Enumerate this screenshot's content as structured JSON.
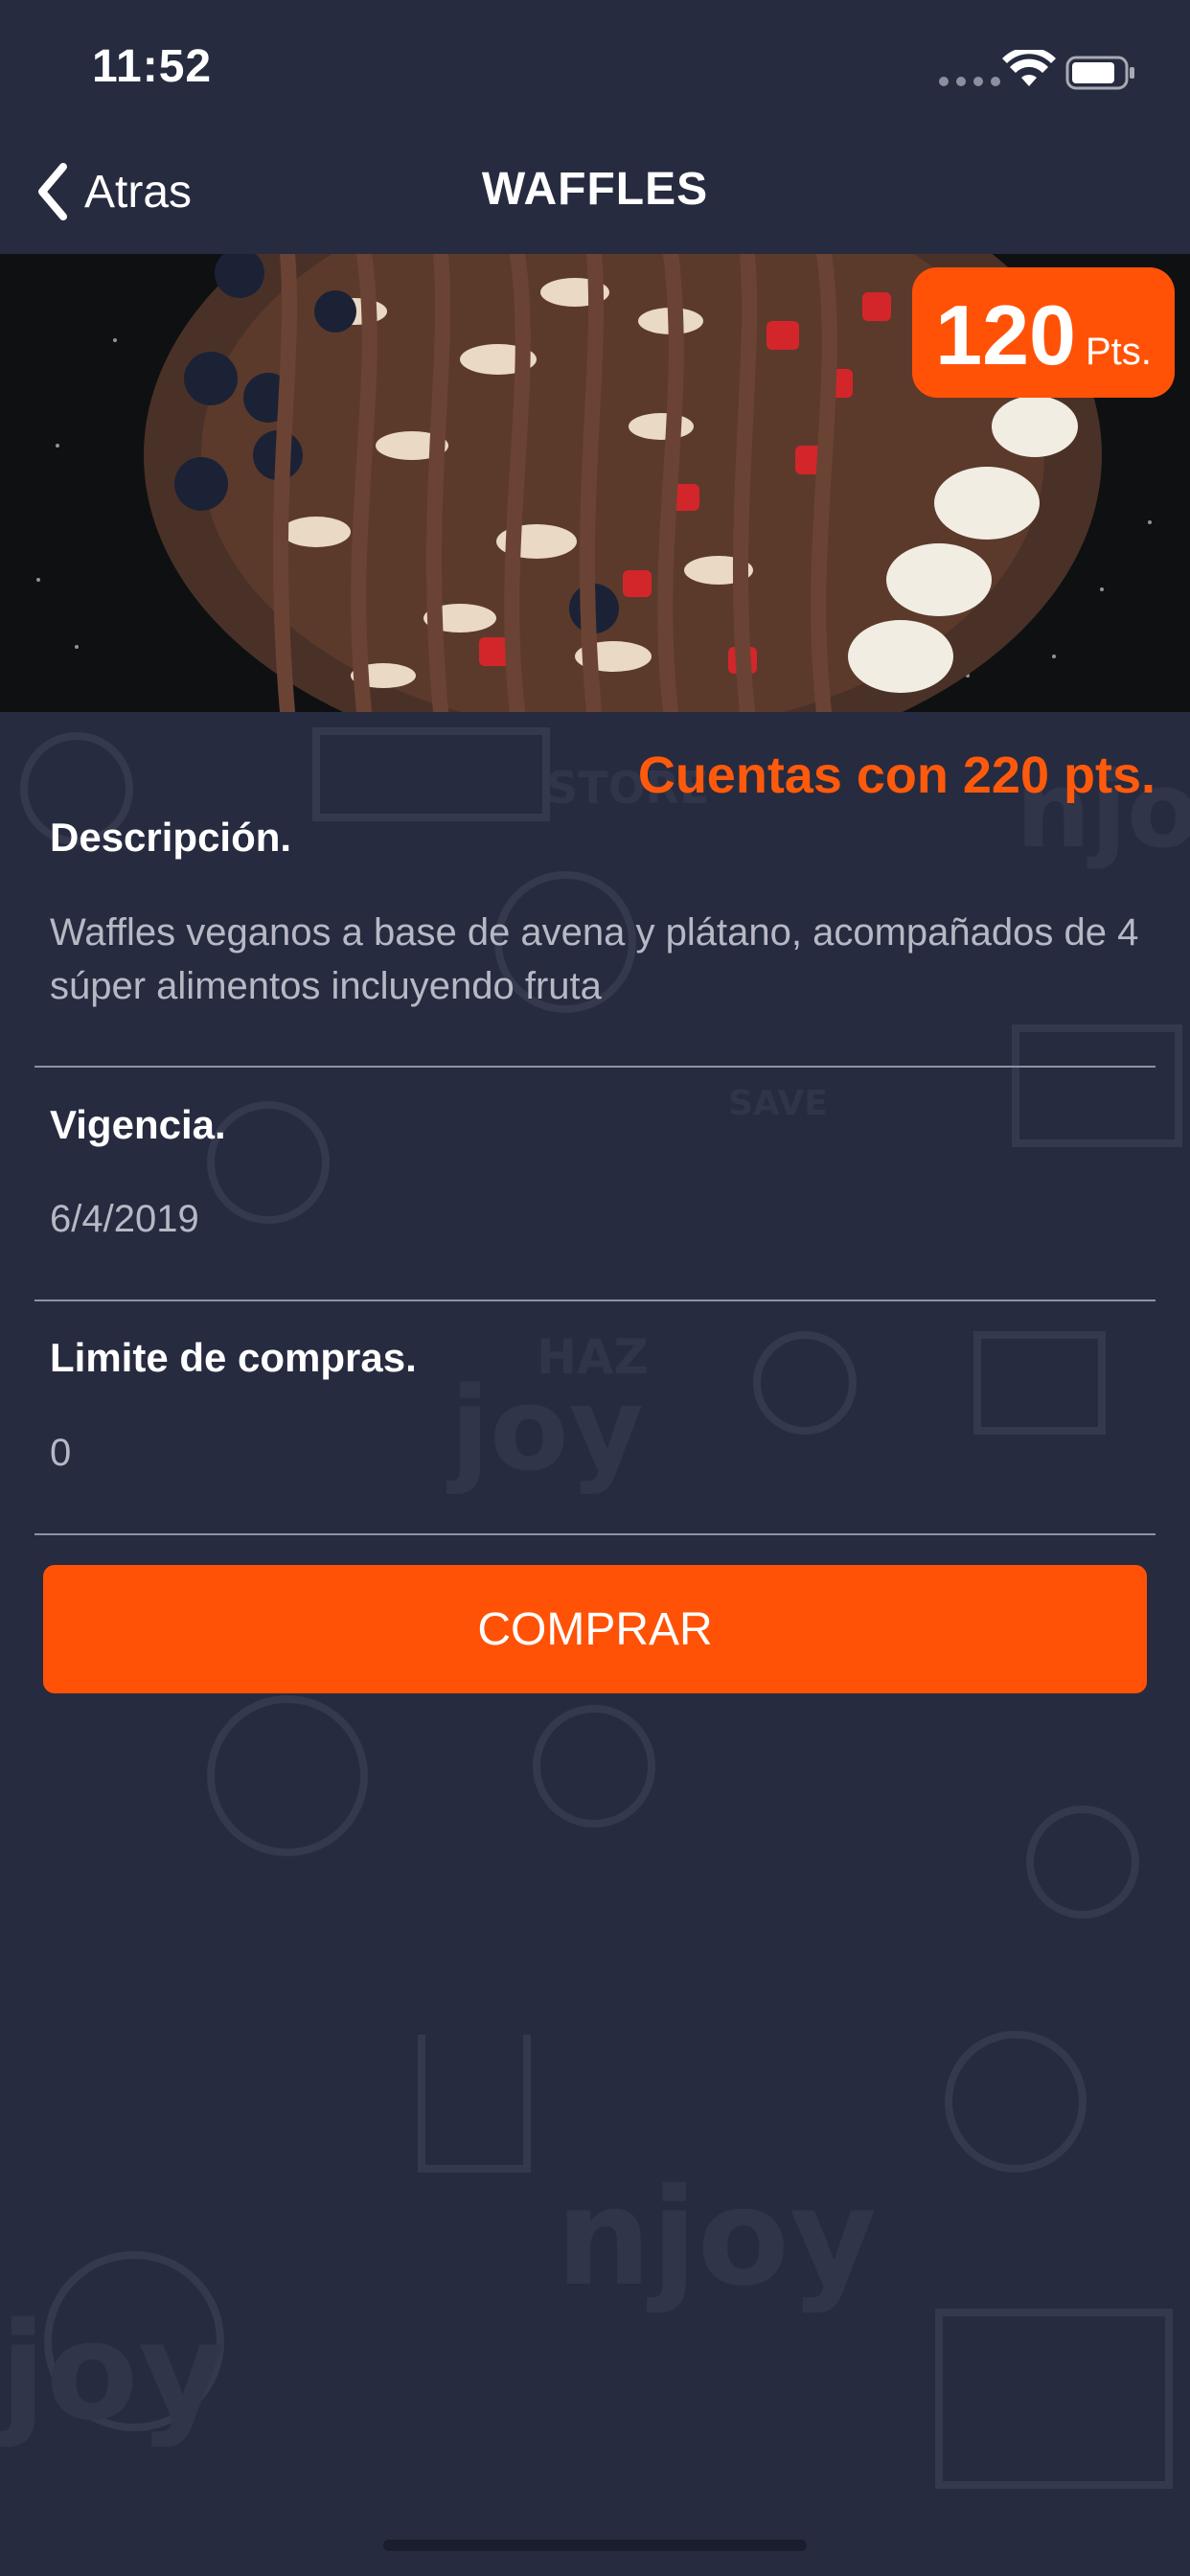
{
  "status_bar": {
    "time": "11:52"
  },
  "nav": {
    "back_label": "Atras",
    "title": "WAFFLES"
  },
  "product": {
    "points_value": "120",
    "points_unit": "Pts."
  },
  "balance": "Cuentas con 220 pts.",
  "sections": [
    {
      "title": "Descripción.",
      "text": "Waffles veganos a base de avena y plátano, acompañados de 4 súper alimentos incluyendo fruta"
    },
    {
      "title": "Vigencia.",
      "text": "6/4/2019"
    },
    {
      "title": "Limite de compras.",
      "text": "0"
    }
  ],
  "buy_button_label": "COMPRAR",
  "pattern_text": {
    "top": "njoy",
    "middle_small": "HAZ",
    "middle": "joy",
    "lower": "njoy",
    "bottom": "joy",
    "store": "STORE",
    "save": "SAVE"
  },
  "colors": {
    "background": "#262b40",
    "accent": "#ff5207"
  }
}
